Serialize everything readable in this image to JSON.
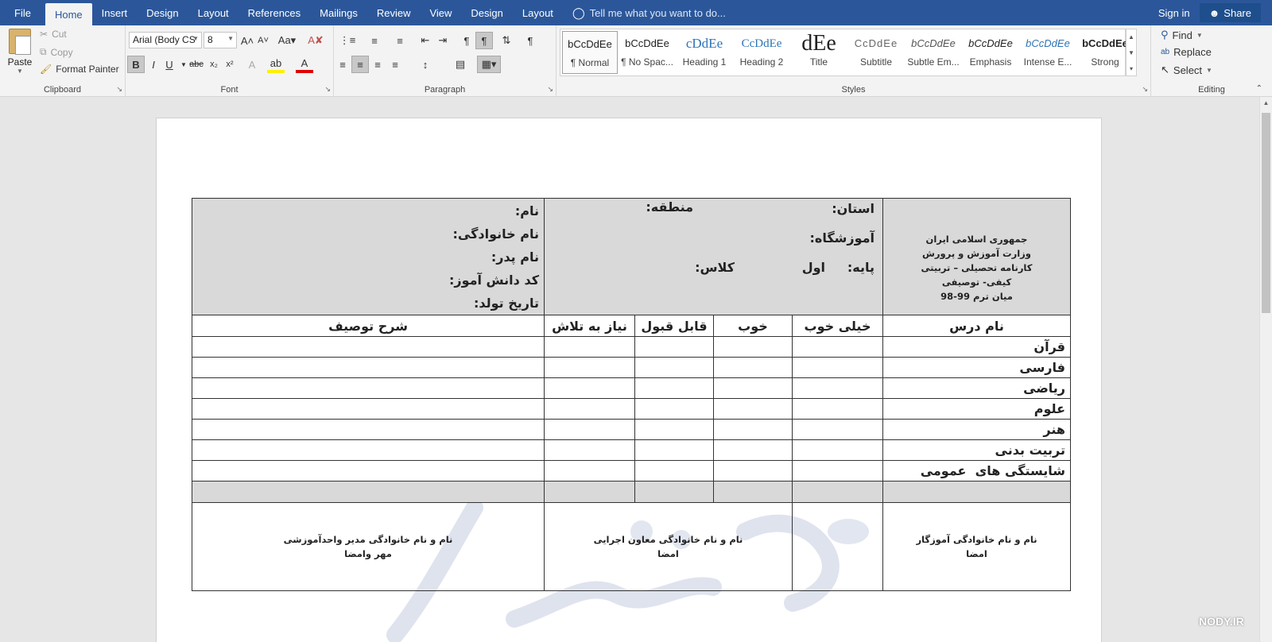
{
  "tabs": {
    "file": "File",
    "home": "Home",
    "insert": "Insert",
    "design": "Design",
    "layout": "Layout",
    "references": "References",
    "mailings": "Mailings",
    "review": "Review",
    "view": "View",
    "design2": "Design",
    "layout2": "Layout",
    "tell_me": "Tell me what you want to do...",
    "sign_in": "Sign in",
    "share": "Share"
  },
  "clipboard": {
    "paste": "Paste",
    "cut": "Cut",
    "copy": "Copy",
    "format_painter": "Format Painter",
    "label": "Clipboard"
  },
  "font": {
    "family": "Arial (Body CS",
    "size": "8",
    "label": "Font"
  },
  "paragraph": {
    "label": "Paragraph"
  },
  "styles": {
    "label": "Styles",
    "items": [
      {
        "sample": "bCcDdEe",
        "name": "¶ Normal"
      },
      {
        "sample": "bCcDdEe",
        "name": "¶ No Spac..."
      },
      {
        "sample": "cDdEe",
        "name": "Heading 1"
      },
      {
        "sample": "CcDdEe",
        "name": "Heading 2"
      },
      {
        "sample": "dEe",
        "name": "Title"
      },
      {
        "sample": "CcDdEe",
        "name": "Subtitle"
      },
      {
        "sample": "bCcDdEe",
        "name": "Subtle Em..."
      },
      {
        "sample": "bCcDdEe",
        "name": "Emphasis"
      },
      {
        "sample": "bCcDdEe",
        "name": "Intense E..."
      },
      {
        "sample": "bCcDdEe",
        "name": "Strong"
      }
    ]
  },
  "editing": {
    "find": "Find",
    "replace": "Replace",
    "select": "Select",
    "label": "Editing"
  },
  "document": {
    "ministry": {
      "line1": "جمهوری اسلامی ایران",
      "line2": "وزارت آموزش و پرورش",
      "line3": "کارنامه تحصیلی – تربیتی",
      "line4": "کیفی- توصیفی",
      "line5": "میان ترم 99-98"
    },
    "school": {
      "province": "استان:",
      "region": "منطقه:",
      "school": "آموزشگاه:",
      "grade_label": "پایه:",
      "grade_value": "اول",
      "class": "کلاس:"
    },
    "student": {
      "name": "نام:",
      "family": "نام خانوادگی:",
      "father": "نام پدر:",
      "code": "کد دانش آموز:",
      "birth": "تاریخ تولد:"
    },
    "columns": {
      "subject": "نام درس",
      "very_good": "خیلی خوب",
      "good": "خوب",
      "acceptable": "قابل قبول",
      "needs_effort": "نیاز به تلاش",
      "description": "شرح توصیف"
    },
    "subjects": [
      "قرآن",
      "فارسی",
      "ریاضی",
      "علوم",
      "هنر",
      "تربیت بدنی",
      "شایستگی های  عمومی"
    ],
    "signatures": {
      "teacher_line1": "نام و نام خانوادگی آموزگار",
      "teacher_line2": "امضا",
      "deputy_line1": "نام و نام خانوادگی معاون اجرایی",
      "deputy_line2": "امضا",
      "principal_line1": "نام و نام خانوادگی مدیر واحدآموزشی",
      "principal_line2": "مهر وامضا"
    }
  },
  "watermark_site": "NODY.IR"
}
